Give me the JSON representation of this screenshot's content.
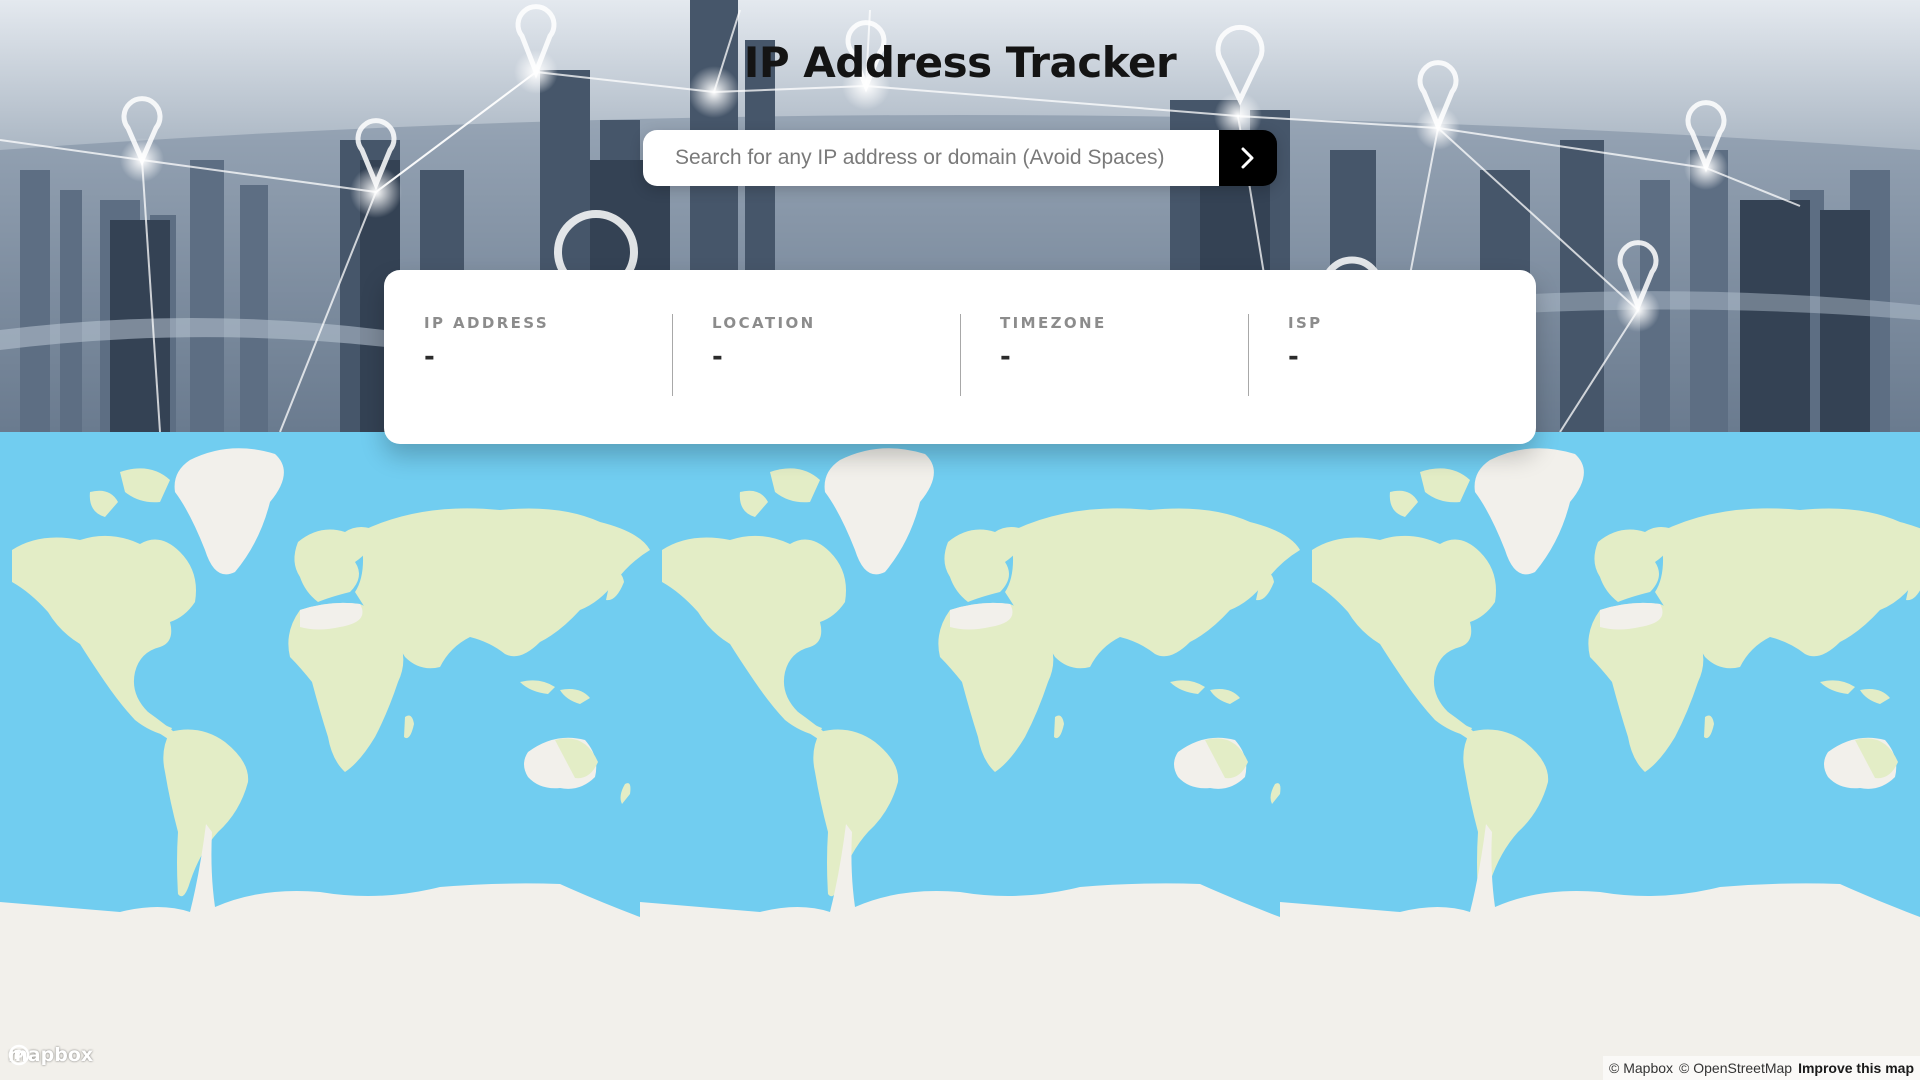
{
  "page": {
    "title": "IP Address Tracker"
  },
  "search": {
    "placeholder": "Search for any IP address or domain (Avoid Spaces)",
    "value": "",
    "submit_icon": "chevron-right-icon"
  },
  "info": [
    {
      "label": "IP ADDRESS",
      "value": "-"
    },
    {
      "label": "LOCATION",
      "value": "-"
    },
    {
      "label": "TIMEZONE",
      "value": "-"
    },
    {
      "label": "ISP",
      "value": "-"
    }
  ],
  "map": {
    "logo_text": "mapbox",
    "attribution_mapbox": "© Mapbox",
    "attribution_osm": "© OpenStreetMap",
    "improve_link": "Improve this map"
  },
  "colors": {
    "ocean": "#71cdf0",
    "land": "#e3edc6",
    "ice": "#f2f0eb",
    "button": "#000000"
  }
}
